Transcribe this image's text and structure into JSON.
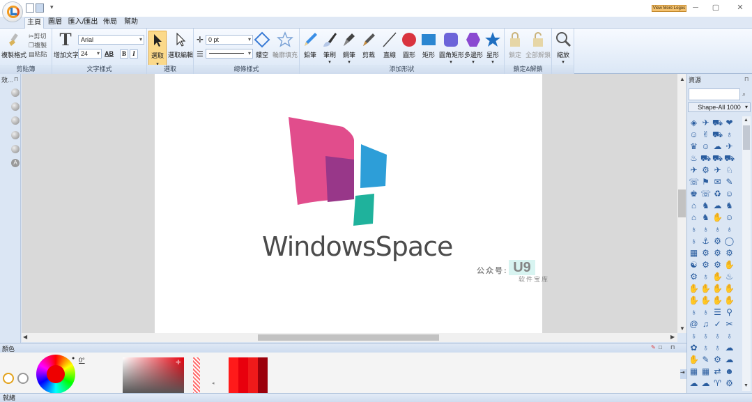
{
  "window": {
    "promo_label": "View More Logos",
    "min": "─",
    "max": "▢",
    "close": "✕"
  },
  "tabs": [
    {
      "label": "主頁"
    },
    {
      "label": "圖層"
    },
    {
      "label": "匯入/匯出"
    },
    {
      "label": "佈局"
    },
    {
      "label": "幫助"
    }
  ],
  "ribbon": {
    "clipboard": {
      "group": "剪貼簿",
      "copy_format": "複製格式",
      "cut": "剪切",
      "copy": "複製",
      "paste": "粘貼"
    },
    "text": {
      "group": "文字樣式",
      "add_text": "增加文字",
      "font": "Arial",
      "size": "24",
      "bold": "B",
      "italic": "I",
      "ab": "AB"
    },
    "select": {
      "group": "選取",
      "select": "選取",
      "select_edit": "選取編輯"
    },
    "outline": {
      "group": "總條樣式",
      "width": "0 pt",
      "hollow": "鏤空",
      "outline_fill": "輪廓填充"
    },
    "shapes": {
      "group": "添加形狀",
      "pencil": "鉛筆",
      "brush": "筆刷",
      "pen": "鋼筆",
      "clip": "剪裁",
      "line": "直線",
      "circle": "圓形",
      "rect": "矩形",
      "round_rect": "圓角矩形",
      "polygon": "多邊形",
      "star": "星形"
    },
    "lock": {
      "group": "鎖定&解鎖",
      "lock": "鎖定",
      "unlock_all": "全部解鎖"
    },
    "zoom": {
      "label": "縮放"
    }
  },
  "left_panel": {
    "title": "效..."
  },
  "canvas": {
    "logo_text": "WindowsSpace",
    "watermark_line1": "公众号:",
    "watermark_brand": "U9",
    "watermark_line2": "软件宝库"
  },
  "color_panel": {
    "title": "顏色",
    "angle": "0°"
  },
  "right_panel": {
    "title": "資源",
    "category": "Shape-All 1000",
    "icons": [
      "◈",
      "✈",
      "⛟",
      "❤",
      "☺",
      "✌",
      "⛟",
      "♁",
      "♛",
      "☺",
      "☁",
      "✈",
      "♨",
      "⛟",
      "⛟",
      "⛟",
      "✈",
      "⚙",
      "✈",
      "♘",
      "☏",
      "⚑",
      "✉",
      "✎",
      "♚",
      "☏",
      "♻",
      "☺",
      "⌂",
      "♞",
      "☁",
      "♞",
      "⌂",
      "♞",
      "✋",
      "☺",
      "♁",
      "♁",
      "♁",
      "♁",
      "♁",
      "⚓",
      "⚙",
      "◯",
      "▦",
      "⚙",
      "⚙",
      "⚙",
      "☯",
      "⚙",
      "⚙",
      "✋",
      "⚙",
      "♁",
      "✋",
      "♨",
      "✋",
      "✋",
      "✋",
      "✋",
      "✋",
      "✋",
      "✋",
      "✋",
      "♁",
      "♁",
      "☰",
      "⚲",
      "@",
      "♫",
      "✓",
      "✂",
      "♁",
      "♁",
      "♁",
      "♁",
      "✿",
      "♁",
      "♁",
      "☁",
      "✋",
      "✎",
      "⚙",
      "☁",
      "▦",
      "▦",
      "⇄",
      "☻",
      "☁",
      "☁",
      "♈",
      "⚙",
      "⚙",
      "✺",
      "⚙",
      "♋",
      "☼",
      "▣",
      "◐",
      "☗"
    ]
  },
  "status": {
    "text": "就緒"
  }
}
